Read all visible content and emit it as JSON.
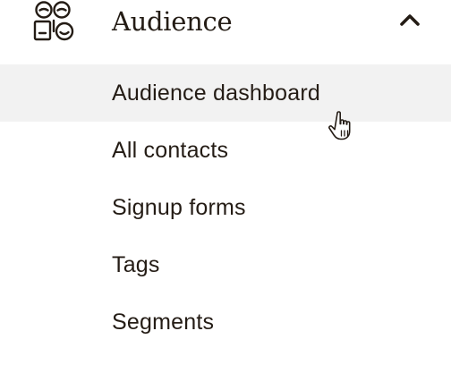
{
  "section": {
    "title": "Audience",
    "icon": "audience-faces-icon",
    "toggle_icon": "chevron-up-icon",
    "expanded": true
  },
  "submenu": {
    "items": [
      {
        "label": "Audience dashboard",
        "hovered": true
      },
      {
        "label": "All contacts",
        "hovered": false
      },
      {
        "label": "Signup forms",
        "hovered": false
      },
      {
        "label": "Tags",
        "hovered": false
      },
      {
        "label": "Segments",
        "hovered": false
      }
    ]
  },
  "pointer": {
    "icon": "hand-pointer-cursor-icon"
  },
  "colors": {
    "text": "#241c15",
    "hover_background": "#f2f2f2",
    "background": "#ffffff"
  }
}
